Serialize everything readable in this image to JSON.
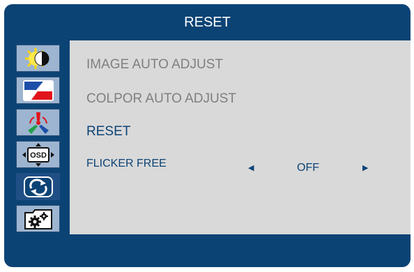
{
  "header": {
    "title": "RESET"
  },
  "sidebar": {
    "items": [
      {
        "icon": "brightness-contrast-icon"
      },
      {
        "icon": "image-setup-icon"
      },
      {
        "icon": "color-icon"
      },
      {
        "icon": "osd-icon",
        "label": "OSD"
      },
      {
        "icon": "reset-icon",
        "active": true
      },
      {
        "icon": "extra-settings-icon"
      }
    ]
  },
  "menu": {
    "items": [
      {
        "label": "IMAGE AUTO ADJUST"
      },
      {
        "label": "COLPOR AUTO ADJUST"
      },
      {
        "label": "RESET",
        "selected": true
      }
    ],
    "flicker": {
      "label": "FLICKER FREE",
      "value": "OFF"
    }
  },
  "colors": {
    "frame": "#0c4375",
    "content_bg": "#d9d9d9",
    "sidebar_item": "#9db5d0",
    "sidebar_active": "#1f4f85",
    "text_inactive": "#7f7f7f",
    "text_active": "#0c4375"
  }
}
